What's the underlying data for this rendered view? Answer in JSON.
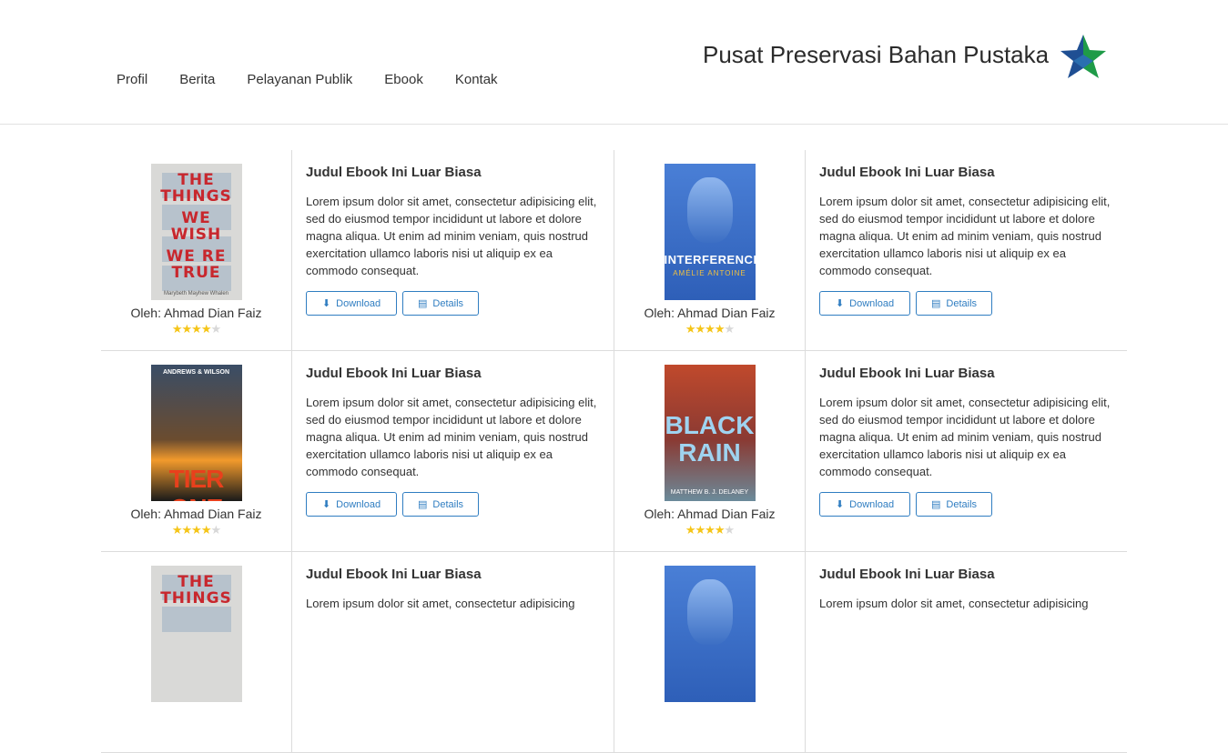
{
  "nav": {
    "items": [
      "Profil",
      "Berita",
      "Pelayanan Publik",
      "Ebook",
      "Kontak"
    ]
  },
  "site_title": "Pusat Preservasi Bahan Pustaka",
  "logo_icon": "star-logo-icon",
  "colors": {
    "accent": "#2f7dc1",
    "star_rating": "#f5c518",
    "logo_green": "#1f9b48",
    "logo_blue": "#1f4f93"
  },
  "ebooks": [
    {
      "title": "Judul Ebook Ini Luar Biasa",
      "desc": "Lorem ipsum dolor sit amet, consectetur adipisicing elit, sed do eiusmod tempor incididunt ut labore et dolore magna aliqua. Ut enim ad minim veniam, quis nostrud exercitation ullamco laboris nisi ut aliquip ex ea commodo consequat.",
      "author": "Oleh: Ahmad Dian Faiz",
      "rating": 4,
      "download_label": "Download",
      "details_label": "Details",
      "cover": {
        "lines": [
          "THE",
          "THINGS",
          "WE",
          "WISH",
          "WE RE",
          "TRUE"
        ],
        "author": "Marybeth Mayhew Whalen"
      }
    },
    {
      "title": "Judul Ebook Ini Luar Biasa",
      "desc": "Lorem ipsum dolor sit amet, consectetur adipisicing elit, sed do eiusmod tempor incididunt ut labore et dolore magna aliqua. Ut enim ad minim veniam, quis nostrud exercitation ullamco laboris nisi ut aliquip ex ea commodo consequat.",
      "author": "Oleh: Ahmad Dian Faiz",
      "rating": 4,
      "download_label": "Download",
      "details_label": "Details",
      "cover": {
        "title": "INTERFERENCE",
        "author": "AMÉLIE ANTOINE"
      }
    },
    {
      "title": "Judul Ebook Ini Luar Biasa",
      "desc": "Lorem ipsum dolor sit amet, consectetur adipisicing elit, sed do eiusmod tempor incididunt ut labore et dolore magna aliqua. Ut enim ad minim veniam, quis nostrud exercitation ullamco laboris nisi ut aliquip ex ea commodo consequat.",
      "author": "Oleh: Ahmad Dian Faiz",
      "rating": 4,
      "download_label": "Download",
      "details_label": "Details",
      "cover": {
        "top": "ANDREWS & WILSON",
        "title": "TIER ONE"
      }
    },
    {
      "title": "Judul Ebook Ini Luar Biasa",
      "desc": "Lorem ipsum dolor sit amet, consectetur adipisicing elit, sed do eiusmod tempor incididunt ut labore et dolore magna aliqua. Ut enim ad minim veniam, quis nostrud exercitation ullamco laboris nisi ut aliquip ex ea commodo consequat.",
      "author": "Oleh: Ahmad Dian Faiz",
      "rating": 4,
      "download_label": "Download",
      "details_label": "Details",
      "cover": {
        "title": "BLACK RAIN",
        "author": "MATTHEW B. J. DELANEY"
      }
    },
    {
      "title": "Judul Ebook Ini Luar Biasa",
      "desc": "Lorem ipsum dolor sit amet, consectetur adipisicing",
      "cover": {
        "lines": [
          "THE",
          "THINGS"
        ]
      }
    },
    {
      "title": "Judul Ebook Ini Luar Biasa",
      "desc": "Lorem ipsum dolor sit amet, consectetur adipisicing"
    }
  ]
}
